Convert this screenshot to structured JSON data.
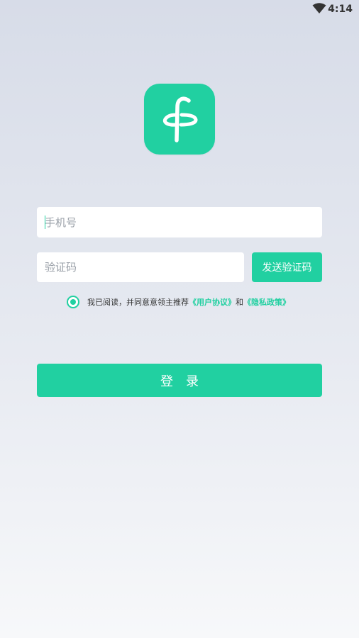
{
  "status_bar": {
    "time": "4:14",
    "icons": [
      "wifi-icon"
    ]
  },
  "logo": {
    "icon": "app-logo-icon",
    "colors": {
      "background": "#21d0a1",
      "mark": "#ffffff"
    }
  },
  "form": {
    "phone_placeholder": "手机号",
    "code_placeholder": "验证码",
    "send_code_label": "发送验证码"
  },
  "agreement": {
    "checked": true,
    "prefix": "我已阅读，并同意意领主推荐",
    "user_agreement": "《用户协议》",
    "connector": "和",
    "privacy_policy": "《隐私政策》"
  },
  "login_label": "登录",
  "colors": {
    "accent": "#21d0a1",
    "button_text": "#ffffff",
    "background_top": "#d7dce8",
    "background_bottom": "#f7f8fa"
  }
}
